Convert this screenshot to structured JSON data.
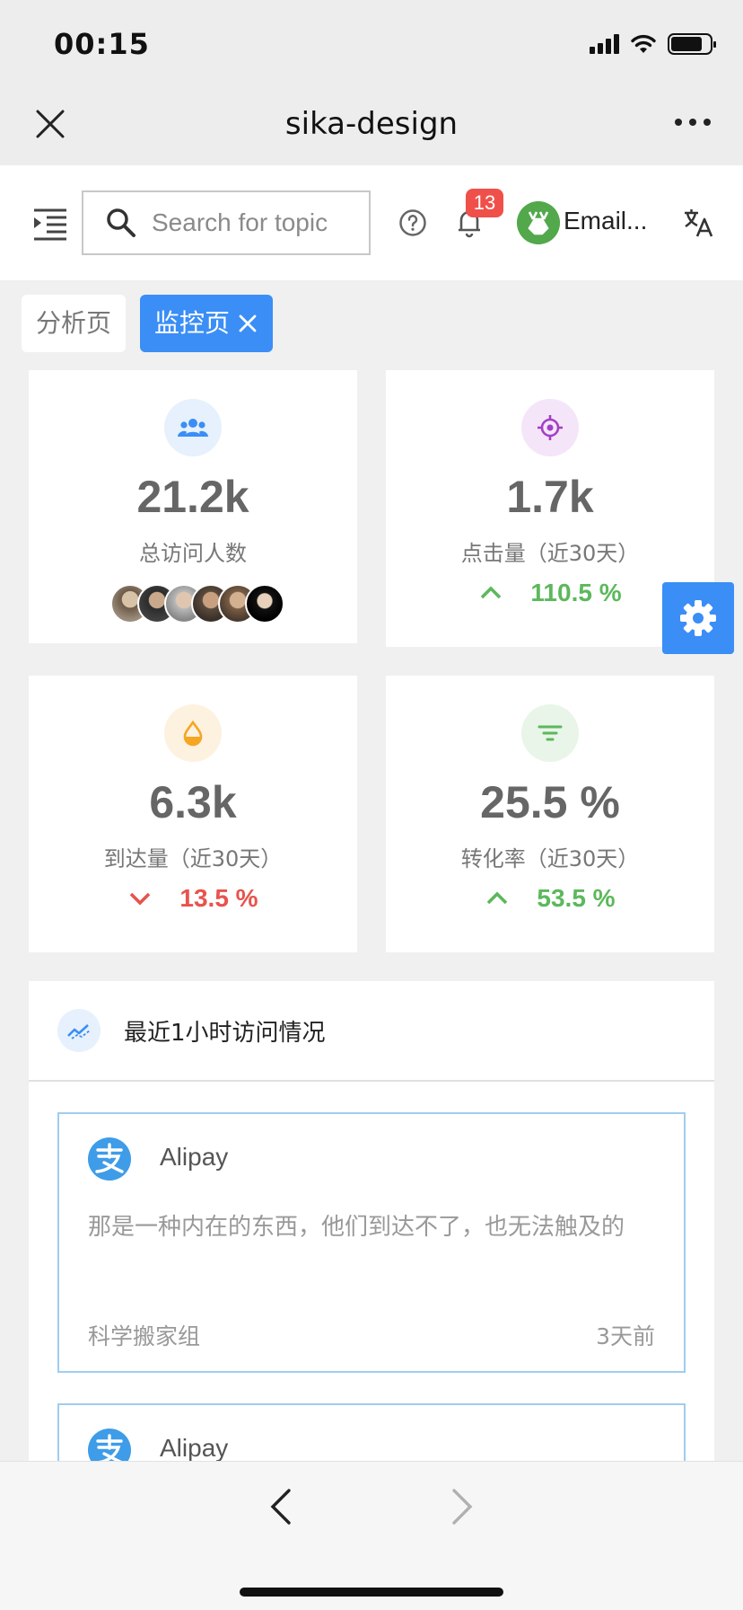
{
  "status_bar": {
    "time": "00:15"
  },
  "nav": {
    "title": "sika-design"
  },
  "header": {
    "search_placeholder": "Search for topic",
    "notification_count": "13",
    "user_name": "Email..."
  },
  "tabs": [
    {
      "label": "分析页"
    },
    {
      "label": "监控页"
    }
  ],
  "stats": [
    {
      "value": "21.2k",
      "label": "总访问人数",
      "icon": "team-icon",
      "icon_color": "#3a8ef6"
    },
    {
      "value": "1.7k",
      "label": "点击量（近30天）",
      "trend": "110.5 %",
      "direction": "up",
      "icon": "aim-icon",
      "icon_color": "#a33fc6"
    },
    {
      "value": "6.3k",
      "label": "到达量（近30天）",
      "trend": "13.5 %",
      "direction": "down",
      "icon": "drop-icon",
      "icon_color": "#f5a623"
    },
    {
      "value": "25.5 %",
      "label": "转化率（近30天）",
      "trend": "53.5 %",
      "direction": "up",
      "icon": "filter-icon",
      "icon_color": "#5cb85c"
    }
  ],
  "recent": {
    "title": "最近1小时访问情况",
    "items": [
      {
        "name": "Alipay",
        "desc": "那是一种内在的东西，他们到达不了，也无法触及的",
        "group": "科学搬家组",
        "ago": "3天前"
      },
      {
        "name": "Alipay"
      }
    ]
  },
  "colors": {
    "primary": "#3a8ef6",
    "up": "#5cb85c",
    "down": "#e8534d",
    "badge": "#f0504a"
  }
}
